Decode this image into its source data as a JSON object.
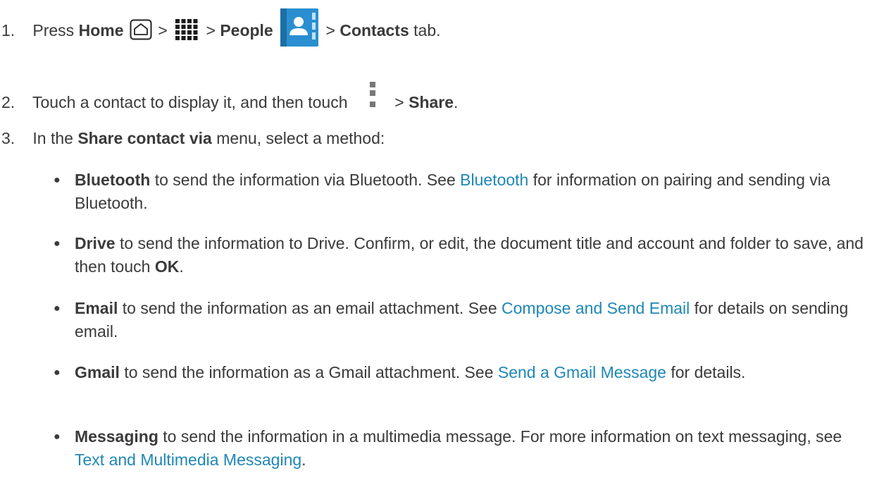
{
  "steps": [
    {
      "number": "1.",
      "press": "Press",
      "home_label": "Home",
      "sep1": ">",
      "sep2": ">",
      "people_label": "People",
      "sep3": ">",
      "contacts_label": "Contacts",
      "tab_word": "tab."
    },
    {
      "number": "2.",
      "text_before": "Touch a contact to display it, and then touch",
      "sep": ">",
      "share_label": "Share",
      "end": "."
    },
    {
      "number": "3.",
      "text_before": "In the",
      "menu_name": "Share contact via",
      "text_after": "menu, select a method:"
    }
  ],
  "methods": [
    {
      "name": "Bluetooth",
      "text1": "to send the information via Bluetooth. See",
      "link": "Bluetooth",
      "text2": "for information on pairing and sending via Bluetooth."
    },
    {
      "name": "Drive",
      "text1": "to send the information to Drive. Confirm, or edit, the document title and account and folder to save, and then touch",
      "ok_label": "OK",
      "text2": "."
    },
    {
      "name": "Email",
      "text1": "to send the information as an email attachment. See",
      "link": "Compose and Send Email",
      "text2": "for details on sending email."
    },
    {
      "name": "Gmail",
      "text1": "to send the information as a Gmail attachment. See",
      "link": "Send a Gmail Message",
      "text2": "for details."
    },
    {
      "name": "Messaging",
      "text1": "to send the information in a multimedia message. For more information on text messaging, see",
      "link": "Text and Multimedia Messaging",
      "text2": "."
    }
  ],
  "bullet_glyph": "●",
  "colors": {
    "text": "#3a3a3a",
    "link": "#1f87b5",
    "people_icon_blue": "#2a8fd0"
  },
  "icons": [
    "home-icon",
    "apps-grid-icon",
    "people-app-icon",
    "menu-icon"
  ]
}
